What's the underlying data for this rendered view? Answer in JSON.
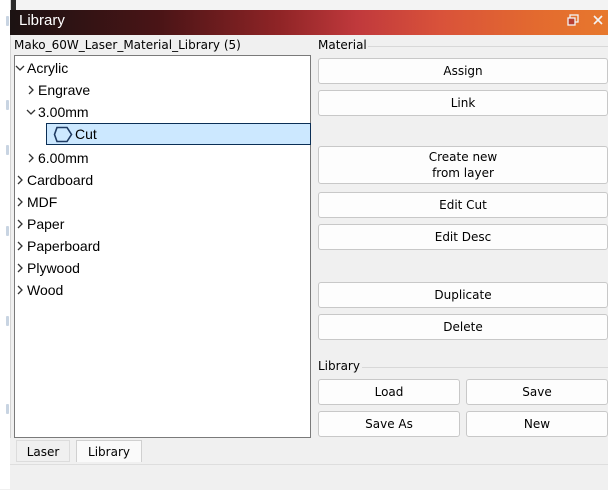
{
  "window": {
    "title": "Library"
  },
  "library_header": "Mako_60W_Laser_Material_Library (5)",
  "tree": {
    "nodes": [
      {
        "label": "Acrylic",
        "chevron": "expanded"
      },
      {
        "label": "Engrave",
        "chevron": "collapsed"
      },
      {
        "label": "3.00mm",
        "chevron": "expanded"
      },
      {
        "label": "Cut",
        "selected": true,
        "icon": "polygon-icon"
      },
      {
        "label": "6.00mm",
        "chevron": "collapsed"
      },
      {
        "label": "Cardboard",
        "chevron": "collapsed"
      },
      {
        "label": "MDF",
        "chevron": "collapsed"
      },
      {
        "label": "Paper",
        "chevron": "collapsed"
      },
      {
        "label": "Paperboard",
        "chevron": "collapsed"
      },
      {
        "label": "Plywood",
        "chevron": "collapsed"
      },
      {
        "label": "Wood",
        "chevron": "collapsed"
      }
    ]
  },
  "material": {
    "group_label": "Material",
    "assign": "Assign",
    "link": "Link",
    "create_new_line1": "Create new",
    "create_new_line2": "from layer",
    "edit_cut": "Edit Cut",
    "edit_desc": "Edit Desc",
    "duplicate": "Duplicate",
    "delete": "Delete"
  },
  "library": {
    "group_label": "Library",
    "load": "Load",
    "save": "Save",
    "save_as": "Save As",
    "new": "New"
  },
  "tabs": [
    {
      "label": "Laser",
      "active": false
    },
    {
      "label": "Library",
      "active": true
    }
  ],
  "colors": {
    "title_gradient_start": "#1b1212",
    "title_gradient_end": "#e7782d",
    "selection_fill": "#cce8ff"
  }
}
